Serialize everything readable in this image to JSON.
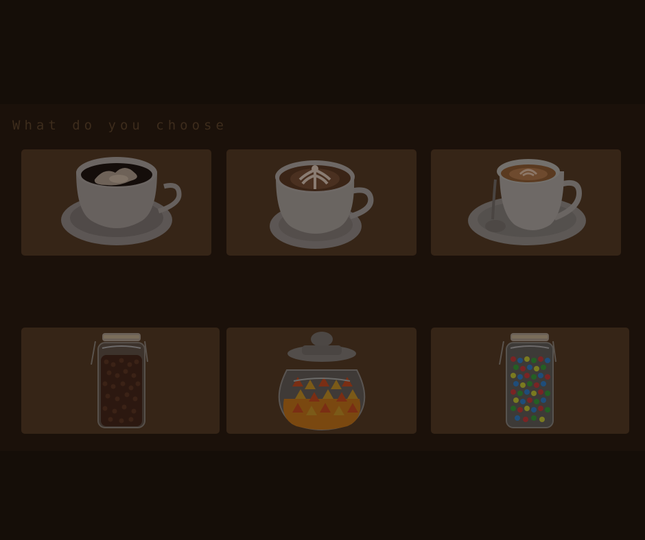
{
  "screen": {
    "prompt": "What do you choose"
  },
  "cards": [
    {
      "id": "coffee-black-foam",
      "icon": "coffee-cup-icon"
    },
    {
      "id": "latte-art",
      "icon": "latte-cup-icon"
    },
    {
      "id": "cappuccino-spoon",
      "icon": "cappuccino-cup-icon"
    },
    {
      "id": "coffee-bean-jar",
      "icon": "coffee-bean-jar-icon"
    },
    {
      "id": "candy-corn-jar",
      "icon": "candy-corn-jar-icon"
    },
    {
      "id": "gumball-jar",
      "icon": "gumball-jar-icon"
    }
  ],
  "colors": {
    "background": "#150e08",
    "panel": "#1b110a",
    "card": "#362517",
    "prompt_text": "#3d2c1c"
  }
}
